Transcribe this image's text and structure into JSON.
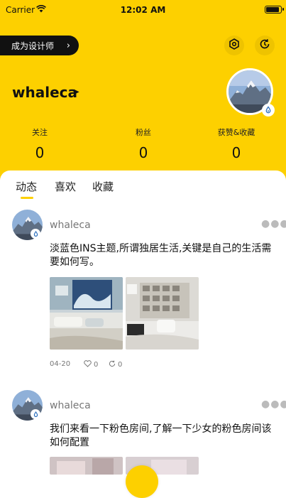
{
  "status_bar": {
    "carrier": "Carrier",
    "time": "12:02 AM"
  },
  "profile": {
    "designer_button": "成为设计师",
    "username": "whaleca",
    "stats": [
      {
        "label": "关注",
        "value": "0"
      },
      {
        "label": "粉丝",
        "value": "0"
      },
      {
        "label": "获赞&收藏",
        "value": "0"
      }
    ]
  },
  "tabs": [
    "动态",
    "喜欢",
    "收藏"
  ],
  "posts": [
    {
      "username": "whaleca",
      "text": "淡蓝色INS主题,所谓独居生活,关键是自己的生活需要如何写。",
      "date": "04-20",
      "likes": "0",
      "comments": "0"
    },
    {
      "username": "whaleca",
      "text": "我们来看一下粉色房间,了解一下少女的粉色房间该如何配置"
    }
  ],
  "colors": {
    "accent": "#fdd000",
    "dark": "#111111"
  }
}
